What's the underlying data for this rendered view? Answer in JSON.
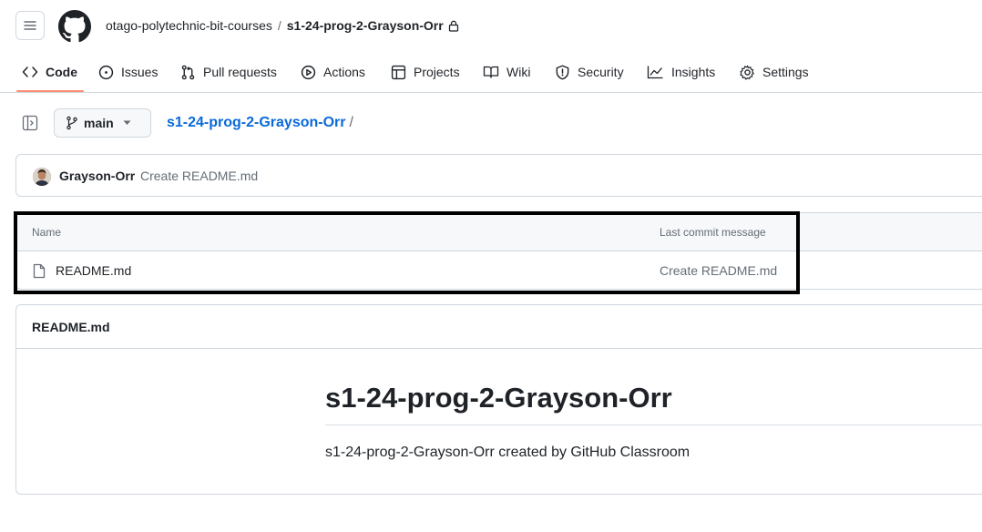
{
  "header": {
    "owner": "otago-polytechnic-bit-courses",
    "separator": "/",
    "repo": "s1-24-prog-2-Grayson-Orr"
  },
  "nav": {
    "items": [
      {
        "label": "Code",
        "icon": "code-icon",
        "active": true
      },
      {
        "label": "Issues",
        "icon": "issue-circle-icon"
      },
      {
        "label": "Pull requests",
        "icon": "pull-request-icon"
      },
      {
        "label": "Actions",
        "icon": "play-circle-icon"
      },
      {
        "label": "Projects",
        "icon": "table-icon"
      },
      {
        "label": "Wiki",
        "icon": "book-icon"
      },
      {
        "label": "Security",
        "icon": "shield-icon"
      },
      {
        "label": "Insights",
        "icon": "graph-icon"
      },
      {
        "label": "Settings",
        "icon": "gear-icon"
      }
    ]
  },
  "branch": {
    "name": "main",
    "path_repo": "s1-24-prog-2-Grayson-Orr",
    "path_sep": "/"
  },
  "commit": {
    "author": "Grayson-Orr",
    "message": "Create README.md"
  },
  "files": {
    "columns": {
      "name": "Name",
      "message": "Last commit message"
    },
    "rows": [
      {
        "name": "README.md",
        "message": "Create README.md",
        "icon": "file-icon"
      }
    ]
  },
  "readme": {
    "filename": "README.md",
    "heading": "s1-24-prog-2-Grayson-Orr",
    "body": "s1-24-prog-2-Grayson-Orr created by GitHub Classroom"
  },
  "colors": {
    "accent_underline": "#fd8c73",
    "link": "#0969da",
    "muted": "#656d76",
    "border": "#d0d7de",
    "highlight_box": "#000000"
  }
}
